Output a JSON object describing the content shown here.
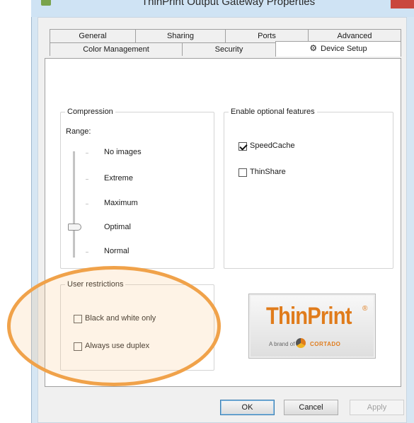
{
  "window": {
    "title": "ThinPrint Output Gateway Properties"
  },
  "tabs_row1": [
    {
      "label": "General"
    },
    {
      "label": "Sharing"
    },
    {
      "label": "Ports"
    },
    {
      "label": "Advanced"
    }
  ],
  "tabs_row2": [
    {
      "label": "Color Management"
    },
    {
      "label": "Security"
    },
    {
      "label": "Device Setup",
      "icon": "gear-icon",
      "active": true
    }
  ],
  "compression": {
    "title": "Compression",
    "range_label": "Range:",
    "levels": [
      "No images",
      "Extreme",
      "Maximum",
      "Optimal",
      "Normal"
    ],
    "selected": "Optimal"
  },
  "features": {
    "title": "Enable optional features",
    "speedcache": {
      "label": "SpeedCache",
      "checked": true
    },
    "thinshare": {
      "label": "ThinShare",
      "checked": false
    }
  },
  "restrictions": {
    "title": "User restrictions",
    "bw": {
      "label": "Black and white only",
      "checked": false
    },
    "duplex": {
      "label": "Always use duplex",
      "checked": false
    }
  },
  "logo": {
    "brand": "ThinPrint",
    "reg": "®",
    "sub": "A brand of",
    "company": "CORTADO"
  },
  "buttons": {
    "ok": "OK",
    "cancel": "Cancel",
    "apply": "Apply"
  },
  "colors": {
    "accent": "#e07c1c",
    "highlight": "#f0a24a"
  }
}
